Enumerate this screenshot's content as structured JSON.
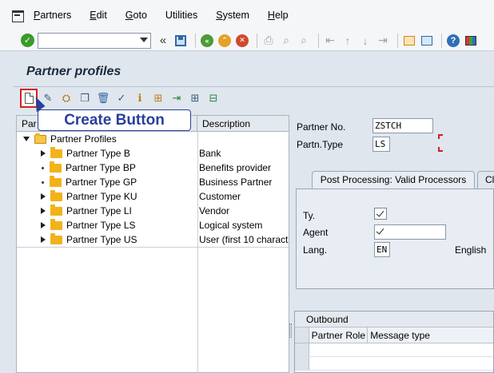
{
  "menu": {
    "items": [
      "Partners",
      "Edit",
      "Goto",
      "Utilities",
      "System",
      "Help"
    ],
    "underline_first": [
      true,
      true,
      true,
      false,
      true,
      true
    ]
  },
  "toolbar": {
    "command_field_value": ""
  },
  "page_title": "Partner profiles",
  "callout": {
    "text": "Create Button"
  },
  "tree": {
    "columns": {
      "name": "Par",
      "description": "Description"
    },
    "root": "Partner Profiles",
    "nodes": [
      {
        "label": "Partner Type B",
        "description": "Bank",
        "marker": "caret"
      },
      {
        "label": "Partner Type BP",
        "description": "Benefits provider",
        "marker": "dot"
      },
      {
        "label": "Partner Type GP",
        "description": "Business Partner",
        "marker": "dot"
      },
      {
        "label": "Partner Type KU",
        "description": "Customer",
        "marker": "caret"
      },
      {
        "label": "Partner Type LI",
        "description": "Vendor",
        "marker": "caret"
      },
      {
        "label": "Partner Type LS",
        "description": "Logical system",
        "marker": "caret"
      },
      {
        "label": "Partner Type US",
        "description": "User (first 10 charact",
        "marker": "caret"
      }
    ]
  },
  "form": {
    "partner_no_label": "Partner No.",
    "partner_no_value": "ZSTCH",
    "partn_type_label": "Partn.Type",
    "partn_type_value": "LS"
  },
  "tabs": {
    "active": "Post Processing: Valid Processors",
    "next": "Cla"
  },
  "processors": {
    "ty_label": "Ty.",
    "agent_label": "Agent",
    "lang_label": "Lang.",
    "lang_value": "EN",
    "lang_text": "English"
  },
  "outbound": {
    "title": "Outbound",
    "columns": [
      "Partner Role",
      "Message type"
    ]
  },
  "colors": {
    "callout_border": "#2a3f9a",
    "highlight_red": "#d42020",
    "folder": "#f2b21a",
    "background": "#dfe6ee"
  }
}
